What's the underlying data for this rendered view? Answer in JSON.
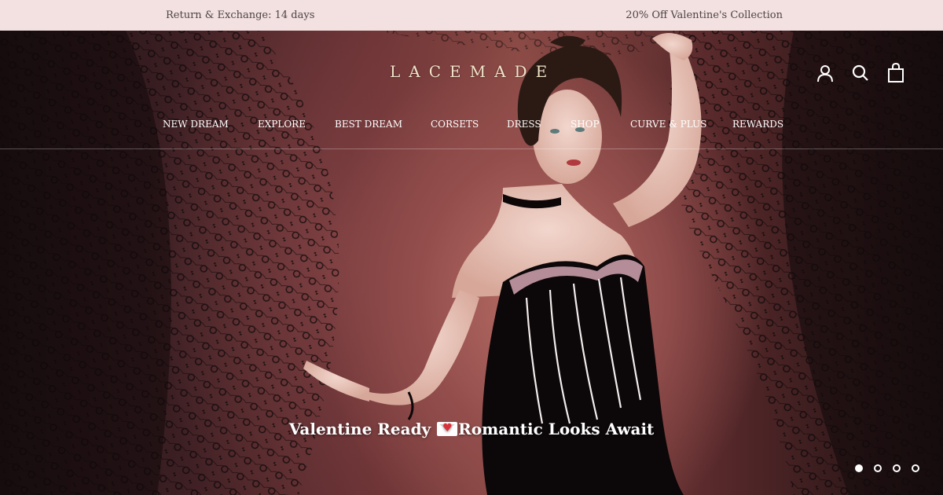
{
  "announcement": {
    "left_text": "Return & Exchange: 14 days",
    "right_text": "20% Off Valentine's Collection"
  },
  "header": {
    "logo_text": "LACEMADE",
    "icons": [
      "account-icon",
      "search-icon",
      "cart-icon"
    ]
  },
  "nav": {
    "items": [
      {
        "label": "NEW DREAM"
      },
      {
        "label": "EXPLORE"
      },
      {
        "label": "BEST DREAM"
      },
      {
        "label": "CORSETS"
      },
      {
        "label": "DRESS"
      },
      {
        "label": "SHOP"
      },
      {
        "label": "CURVE & PLUS"
      },
      {
        "label": "REWARDS"
      }
    ]
  },
  "hero": {
    "caption_before": "Valentine Ready ",
    "caption_after": "Romantic Looks Await",
    "caption_icon": "love-letter-icon",
    "slide_count": 4,
    "active_slide": 1
  },
  "colors": {
    "announcement_bg": "#f3e0e0",
    "announcement_text": "#4d4545",
    "hero_accent": "#a15a55",
    "logo": "#f1e4c8"
  }
}
